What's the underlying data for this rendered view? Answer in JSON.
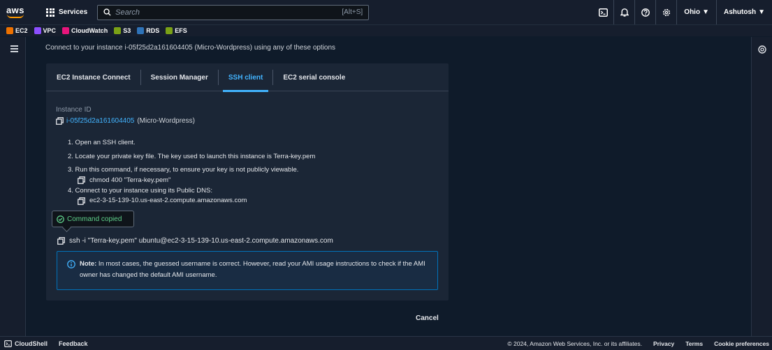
{
  "topnav": {
    "logo_text": "aws",
    "services_label": "Services",
    "search_placeholder": "Search",
    "search_shortcut": "[Alt+S]",
    "region_label": "Ohio",
    "user_label": "Ashutosh"
  },
  "favorites": [
    {
      "label": "EC2",
      "color": "#ed7100"
    },
    {
      "label": "VPC",
      "color": "#8c4fff"
    },
    {
      "label": "CloudWatch",
      "color": "#e7157b"
    },
    {
      "label": "S3",
      "color": "#7aa116"
    },
    {
      "label": "RDS",
      "color": "#2e73b8"
    },
    {
      "label": "EFS",
      "color": "#7aa116"
    }
  ],
  "page": {
    "title": "Connect to your instance i-05f25d2a161604405 (Micro-Wordpress) using any of these options"
  },
  "tabs": [
    {
      "label": "EC2 Instance Connect"
    },
    {
      "label": "Session Manager"
    },
    {
      "label": "SSH client"
    },
    {
      "label": "EC2 serial console"
    }
  ],
  "instance": {
    "label": "Instance ID",
    "id": "i-05f25d2a161604405",
    "name": "(Micro-Wordpress)"
  },
  "steps": {
    "s1": "1. Open an SSH client.",
    "s2": "2. Locate your private key file. The key used to launch this instance is Terra-key.pem",
    "s3": "3. Run this command, if necessary, to ensure your key is not publicly viewable.",
    "s3_cmd": "chmod 400 \"Terra-key.pem\"",
    "s4": "4. Connect to your instance using its Public DNS:",
    "s4_cmd": "ec2-3-15-139-10.us-east-2.compute.amazonaws.com"
  },
  "tooltip": {
    "text": "Command copied"
  },
  "ssh_command": "ssh -i \"Terra-key.pem\" ubuntu@ec2-3-15-139-10.us-east-2.compute.amazonaws.com",
  "note": {
    "bold": "Note:",
    "text": " In most cases, the guessed username is correct. However, read your AMI usage instructions to check if the AMI owner has changed the default AMI username."
  },
  "cancel_label": "Cancel",
  "footer": {
    "cloudshell": "CloudShell",
    "feedback": "Feedback",
    "copyright": "© 2024, Amazon Web Services, Inc. or its affiliates.",
    "privacy": "Privacy",
    "terms": "Terms",
    "cookies": "Cookie preferences"
  },
  "colors": {
    "accent": "#42b4ff",
    "success": "#5fd08a",
    "info_border": "#0073bb"
  }
}
